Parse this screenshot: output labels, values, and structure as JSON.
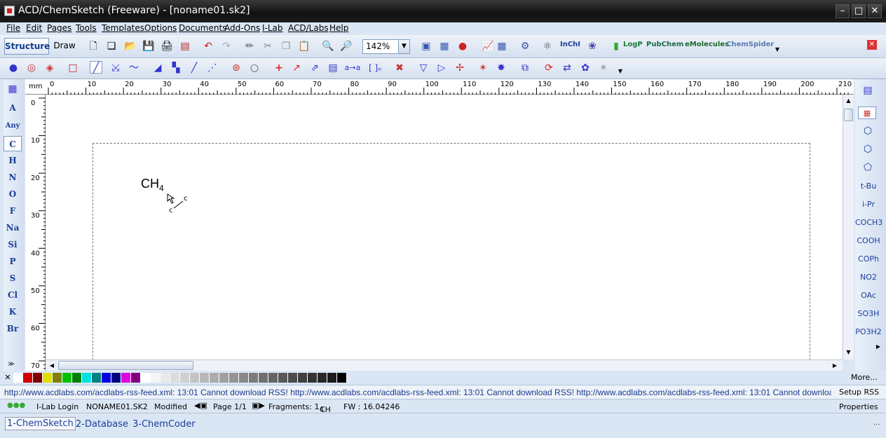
{
  "window": {
    "title": "ACD/ChemSketch (Freeware) - [noname01.sk2]"
  },
  "menu": [
    "File",
    "Edit",
    "Pages",
    "Tools",
    "Templates",
    "Options",
    "Documents",
    "Add-Ons",
    "I-Lab",
    "ACD/Labs",
    "Help"
  ],
  "toolbar": {
    "modes": [
      "Structure",
      "Draw"
    ],
    "zoom_value": "142%",
    "text_buttons": [
      "InChI",
      "LogP",
      "PubChem",
      "eMolecules",
      "ChemSpider"
    ]
  },
  "ruler": {
    "unit": "mm",
    "top_ticks": [
      "0",
      "10",
      "20",
      "30",
      "40",
      "50",
      "60",
      "70",
      "80",
      "90",
      "100",
      "110",
      "120",
      "130",
      "140",
      "150",
      "160",
      "170",
      "180",
      "190",
      "200",
      "210"
    ],
    "left_ticks": [
      "0",
      "10",
      "20",
      "30",
      "40",
      "50",
      "60",
      "70"
    ]
  },
  "elements": [
    "A",
    "Any",
    "C",
    "H",
    "N",
    "O",
    "F",
    "Na",
    "Si",
    "P",
    "S",
    "Cl",
    "K",
    "Br"
  ],
  "right_templates": [
    "t-Bu",
    "i-Pr",
    "COCH3",
    "COOH",
    "COPh",
    "NO2",
    "OAc",
    "SO3H",
    "PO3H2"
  ],
  "canvas": {
    "molecule": "CH",
    "subscript": "4",
    "atom_label": "c"
  },
  "palette": {
    "more_label": "More..."
  },
  "rss": {
    "text": "http://www.acdlabs.com/acdlabs-rss-feed.xml: 13:01 Cannot download RSS!  http://www.acdlabs.com/acdlabs-rss-feed.xml: 13:01 Cannot download RSS!  http://www.acdlabs.com/acdlabs-rss-feed.xml: 13:01 Cannot download RSS!",
    "setup": "Setup RSS"
  },
  "status": {
    "ilab": "I-Lab Login",
    "file": "NONAME01.SK2",
    "modified": "Modified",
    "page": "Page 1/1",
    "fragments": "Fragments: 1",
    "formula": "CH",
    "formula_sub": "4",
    "fw": "FW : 16.04246",
    "properties": "Properties"
  },
  "tabs": [
    "1-ChemSketch",
    "2-Database",
    "3-ChemCoder"
  ],
  "colors": {
    "accent": "#1a3f9a",
    "titlebar": "#1c1c1c"
  }
}
